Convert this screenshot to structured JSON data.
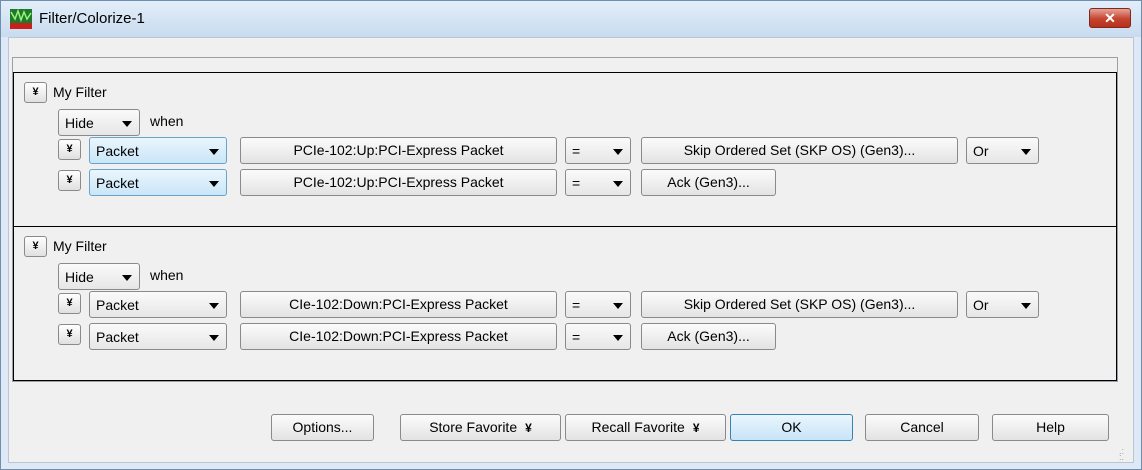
{
  "window": {
    "title": "Filter/Colorize-1",
    "close_symbol": "✕"
  },
  "groups": [
    {
      "expand_symbol": "¥",
      "name": "My Filter",
      "action": "Hide",
      "when_label": "when",
      "conditions": [
        {
          "expand_symbol": "¥",
          "type": "Packet",
          "source": "PCIe-102:Up:PCI-Express Packet",
          "operator": "=",
          "value": "Skip Ordered Set (SKP OS) (Gen3)...",
          "join": "Or"
        },
        {
          "expand_symbol": "¥",
          "type": "Packet",
          "source": "PCIe-102:Up:PCI-Express Packet",
          "operator": "=",
          "value": "Ack (Gen3)..."
        }
      ]
    },
    {
      "expand_symbol": "¥",
      "name": "My Filter",
      "action": "Hide",
      "when_label": "when",
      "conditions": [
        {
          "expand_symbol": "¥",
          "type": "Packet",
          "source": "CIe-102:Down:PCI-Express Packet",
          "operator": "=",
          "value": "Skip Ordered Set (SKP OS) (Gen3)...",
          "join": "Or"
        },
        {
          "expand_symbol": "¥",
          "type": "Packet",
          "source": "CIe-102:Down:PCI-Express Packet",
          "operator": "=",
          "value": "Ack (Gen3)..."
        }
      ]
    }
  ],
  "buttons": {
    "options": "Options...",
    "store_favorite": "Store Favorite",
    "recall_favorite": "Recall Favorite",
    "menu_chevron": "¥",
    "ok": "OK",
    "cancel": "Cancel",
    "help": "Help"
  }
}
